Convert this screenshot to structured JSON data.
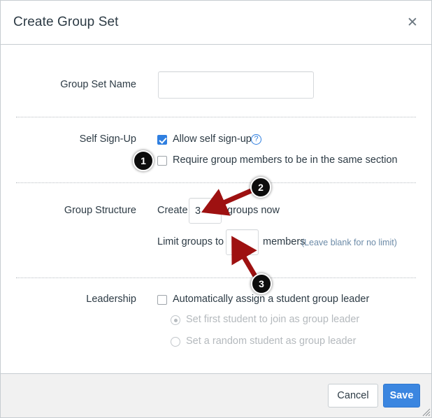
{
  "dialog": {
    "title": "Create Group Set",
    "close_icon": "close-icon"
  },
  "form": {
    "group_set_name": {
      "label": "Group Set Name",
      "value": "",
      "placeholder": ""
    },
    "self_sign_up": {
      "label": "Self Sign-Up",
      "allow_self_signup": {
        "label": "Allow self sign-up",
        "checked": true
      },
      "help_icon": "?",
      "require_same_section": {
        "label": "Require group members to be in the same section",
        "checked": false
      }
    },
    "group_structure": {
      "label": "Group Structure",
      "create_prefix": "Create",
      "create_count": "3",
      "create_suffix": "groups now",
      "limit_prefix": "Limit groups to",
      "limit_value": "",
      "limit_suffix": "members",
      "limit_hint": "(Leave blank for no limit)"
    },
    "leadership": {
      "label": "Leadership",
      "auto_assign": {
        "label": "Automatically assign a student group leader",
        "checked": false
      },
      "options": [
        {
          "label": "Set first student to join as group leader",
          "selected": true,
          "disabled": true
        },
        {
          "label": "Set a random student as group leader",
          "selected": false,
          "disabled": true
        }
      ]
    }
  },
  "footer": {
    "cancel_label": "Cancel",
    "save_label": "Save"
  },
  "annotations": {
    "badges": [
      {
        "number": "1"
      },
      {
        "number": "2"
      },
      {
        "number": "3"
      }
    ],
    "arrow_color": "#9e1111"
  },
  "colors": {
    "accent_blue": "#3b86e0",
    "checkbox_blue": "#2f7fe0",
    "title": "#2d3b45",
    "hint": "#6c8ba8",
    "badge": "#0d0d0d",
    "footer_bg": "#f1f1f1"
  }
}
